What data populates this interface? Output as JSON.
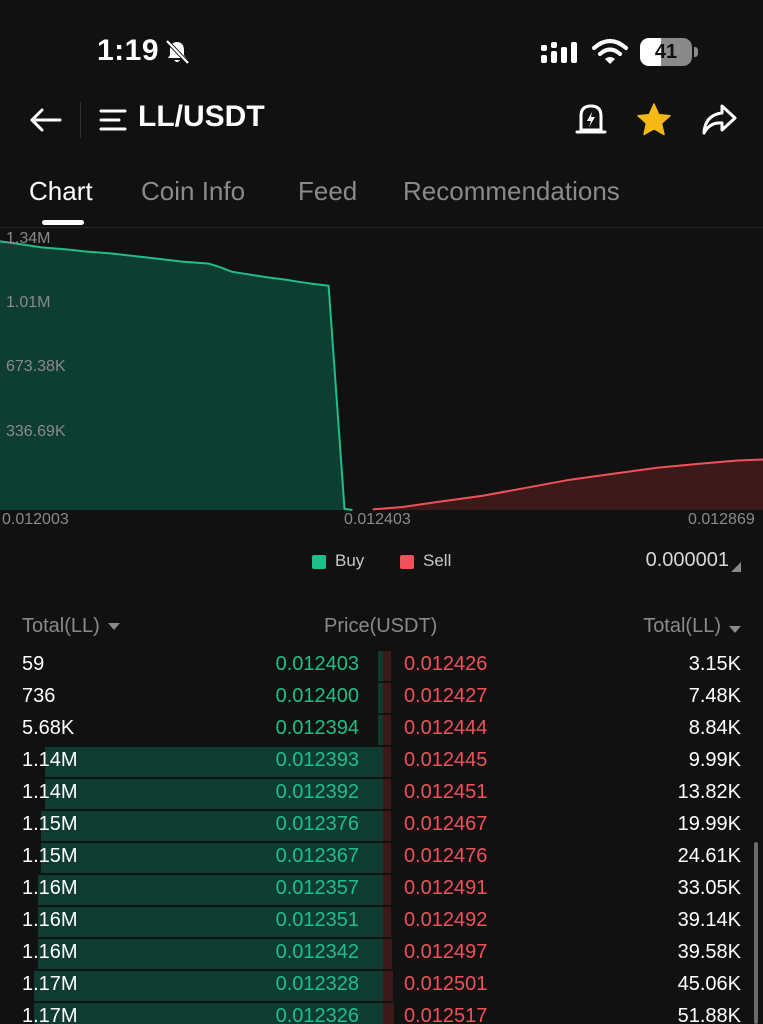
{
  "status_bar": {
    "time": "1:19",
    "battery": "41",
    "battery_level": 0.41
  },
  "header": {
    "pair": "LL/USDT"
  },
  "tabs": [
    {
      "label": "Chart",
      "active": true
    },
    {
      "label": "Coin Info",
      "active": false
    },
    {
      "label": "Feed",
      "active": false
    },
    {
      "label": "Recommendations",
      "active": false
    }
  ],
  "chart_data": {
    "type": "area",
    "y_ticks": [
      "1.34M",
      "1.01M",
      "673.38K",
      "336.69K"
    ],
    "x_ticks": [
      "0.012003",
      "0.012403",
      "0.012869"
    ],
    "ylim": [
      0,
      1346760
    ],
    "xlim": [
      0.012003,
      0.012869
    ],
    "series": [
      {
        "name": "Buy",
        "color": "#1fbf8a",
        "points": [
          [
            0.012003,
            1330000
          ],
          [
            0.01202,
            1320000
          ],
          [
            0.01205,
            1300000
          ],
          [
            0.01208,
            1290000
          ],
          [
            0.0121,
            1280000
          ],
          [
            0.01213,
            1270000
          ],
          [
            0.01217,
            1250000
          ],
          [
            0.01221,
            1230000
          ],
          [
            0.01224,
            1220000
          ],
          [
            0.012254,
            1200000
          ],
          [
            0.012266,
            1180000
          ],
          [
            0.01228,
            1170000
          ],
          [
            0.01231,
            1150000
          ],
          [
            0.012328,
            1140000
          ],
          [
            0.012342,
            1130000
          ],
          [
            0.012357,
            1120000
          ],
          [
            0.012376,
            1110000
          ],
          [
            0.012394,
            5680
          ],
          [
            0.012403,
            59
          ]
        ]
      },
      {
        "name": "Sell",
        "color": "#f0525a",
        "points": [
          [
            0.012426,
            3150
          ],
          [
            0.01246,
            15000
          ],
          [
            0.0125,
            40000
          ],
          [
            0.01255,
            70000
          ],
          [
            0.0126,
            110000
          ],
          [
            0.01265,
            150000
          ],
          [
            0.0127,
            180000
          ],
          [
            0.01275,
            210000
          ],
          [
            0.0128,
            230000
          ],
          [
            0.01284,
            245000
          ],
          [
            0.012869,
            250000
          ]
        ]
      }
    ],
    "grid": false,
    "legend": "bottom-center"
  },
  "legend": {
    "buy": "Buy",
    "sell": "Sell",
    "buy_color": "#1fbf8a",
    "sell_color": "#f0525a"
  },
  "precision": "0.000001",
  "order_book": {
    "header_left": "Total(LL)",
    "header_center": "Price(USDT)",
    "header_right": "Total(LL)",
    "rows": [
      {
        "bid_total": "59",
        "bid_price": "0.012403",
        "ask_price": "0.012426",
        "ask_total": "3.15K",
        "bid_depth": 0.0006,
        "ask_depth": 0.012
      },
      {
        "bid_total": "736",
        "bid_price": "0.012400",
        "ask_price": "0.012427",
        "ask_total": "7.48K",
        "bid_depth": 0.0006,
        "ask_depth": 0.029
      },
      {
        "bid_total": "5.68K",
        "bid_price": "0.012394",
        "ask_price": "0.012444",
        "ask_total": "8.84K",
        "bid_depth": 0.005,
        "ask_depth": 0.034
      },
      {
        "bid_total": "1.14M",
        "bid_price": "0.012393",
        "ask_price": "0.012445",
        "ask_total": "9.99K",
        "bid_depth": 0.97,
        "ask_depth": 0.039
      },
      {
        "bid_total": "1.14M",
        "bid_price": "0.012392",
        "ask_price": "0.012451",
        "ask_total": "13.82K",
        "bid_depth": 0.97,
        "ask_depth": 0.054
      },
      {
        "bid_total": "1.15M",
        "bid_price": "0.012376",
        "ask_price": "0.012467",
        "ask_total": "19.99K",
        "bid_depth": 0.98,
        "ask_depth": 0.078
      },
      {
        "bid_total": "1.15M",
        "bid_price": "0.012367",
        "ask_price": "0.012476",
        "ask_total": "24.61K",
        "bid_depth": 0.98,
        "ask_depth": 0.096
      },
      {
        "bid_total": "1.16M",
        "bid_price": "0.012357",
        "ask_price": "0.012491",
        "ask_total": "33.05K",
        "bid_depth": 0.99,
        "ask_depth": 0.129
      },
      {
        "bid_total": "1.16M",
        "bid_price": "0.012351",
        "ask_price": "0.012492",
        "ask_total": "39.14K",
        "bid_depth": 0.99,
        "ask_depth": 0.153
      },
      {
        "bid_total": "1.16M",
        "bid_price": "0.012342",
        "ask_price": "0.012497",
        "ask_total": "39.58K",
        "bid_depth": 0.99,
        "ask_depth": 0.155
      },
      {
        "bid_total": "1.17M",
        "bid_price": "0.012328",
        "ask_price": "0.012501",
        "ask_total": "45.06K",
        "bid_depth": 1.0,
        "ask_depth": 0.176
      },
      {
        "bid_total": "1.17M",
        "bid_price": "0.012326",
        "ask_price": "0.012517",
        "ask_total": "51.88K",
        "bid_depth": 1.0,
        "ask_depth": 0.203
      }
    ]
  }
}
